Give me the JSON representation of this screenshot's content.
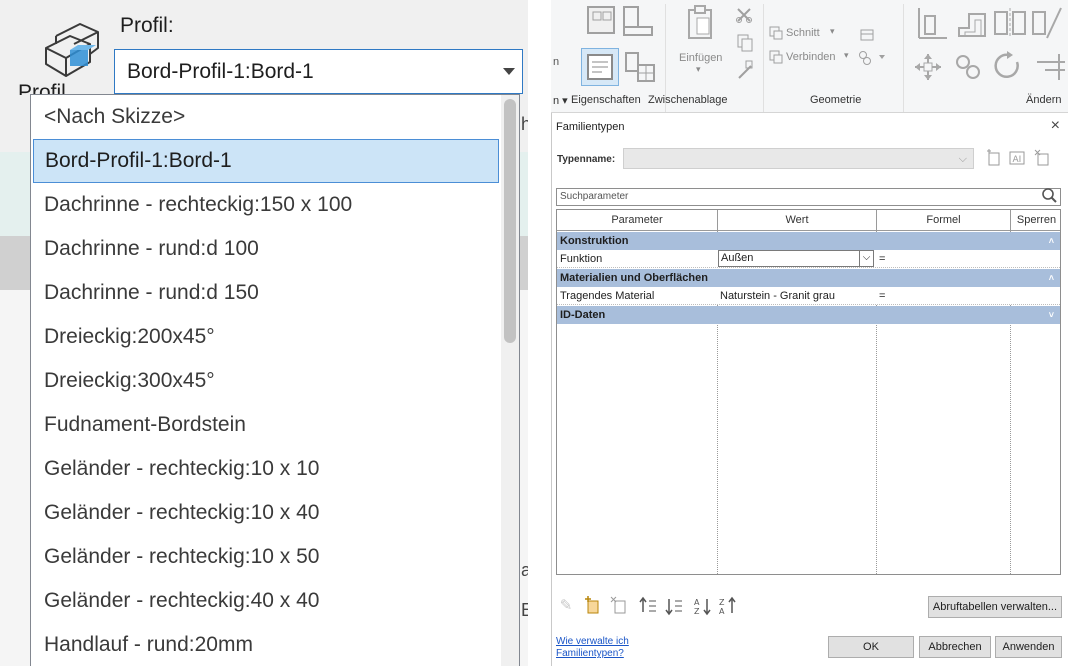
{
  "left": {
    "profil_label": "Profil:",
    "profil_value": "Bord-Profil-1:Bord-1",
    "peek_text": "Profil",
    "dropdown_items": [
      "<Nach Skizze>",
      "Bord-Profil-1:Bord-1",
      "Dachrinne - rechteckig:150 x 100",
      "Dachrinne - rund:d 100",
      "Dachrinne - rund:d 150",
      "Dreieckig:200x45°",
      "Dreieckig:300x45°",
      "Fudnament-Bordstein",
      "Geländer - rechteckig:10 x 10",
      "Geländer - rechteckig:10 x 40",
      "Geländer - rechteckig:10 x 50",
      "Geländer - rechteckig:40 x 40",
      "Handlauf - rund:20mm"
    ],
    "selected_index": 1,
    "edge_chars": [
      "h",
      "a",
      "E"
    ]
  },
  "ribbon": {
    "einfuegen": "Einfügen",
    "schnitt": "Schnitt",
    "verbinden": "Verbinden",
    "groups": [
      "Eigenschaften",
      "Zwischenablage",
      "Geometrie",
      "Ändern"
    ],
    "prefix": "n ▾"
  },
  "dialog": {
    "title": "Familientypen",
    "close": "×",
    "typename_label": "Typenname:",
    "typename_value": "",
    "search_placeholder": "Suchparameter",
    "columns": [
      "Parameter",
      "Wert",
      "Formel",
      "Sperren"
    ],
    "groups": [
      {
        "name": "Konstruktion",
        "chevron": "˄",
        "rows": [
          {
            "parameter": "Funktion",
            "wert": "Außen",
            "formel": "="
          }
        ]
      },
      {
        "name": "Materialien und Oberflächen",
        "chevron": "˄",
        "rows": [
          {
            "parameter": "Tragendes Material",
            "wert": "Naturstein - Granit grau",
            "formel": "="
          }
        ]
      },
      {
        "name": "ID-Daten",
        "chevron": "˅",
        "rows": []
      }
    ],
    "manage_lookup_button": "Abruftabellen verwalten...",
    "help_link": "Wie verwalte ich Familientypen?",
    "ok_button": "OK",
    "cancel_button": "Abbrechen",
    "apply_button": "Anwenden"
  }
}
